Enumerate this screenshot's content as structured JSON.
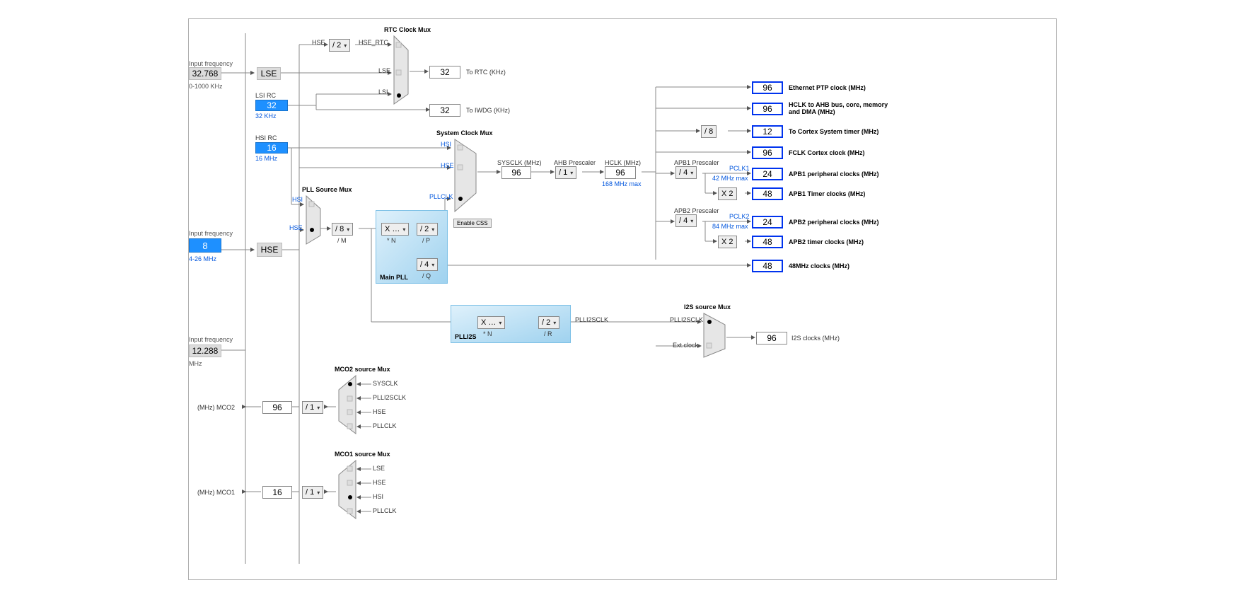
{
  "inputs": {
    "lse_label": "Input frequency",
    "lse_val": "32.768",
    "lse_range": "0-1000 KHz",
    "hse_label": "Input frequency",
    "hse_val": "8",
    "hse_range": "4-26 MHz",
    "i2s_label": "Input frequency",
    "i2s_val": "12.288",
    "i2s_unit": "MHz"
  },
  "sources": {
    "lse": "LSE",
    "lsi_rc": "LSI RC",
    "lsi_val": "32",
    "lsi_unit": "32 KHz",
    "hsi_rc": "HSI RC",
    "hsi_val": "16",
    "hsi_unit": "16 MHz",
    "hse": "HSE"
  },
  "rtc": {
    "title": "RTC Clock Mux",
    "hse_lbl": "HSE",
    "div": "/ 2",
    "hse_rtc": "HSE_RTC",
    "lse_lbl": "LSE",
    "lsi_lbl": "LSI",
    "rtc_val": "32",
    "rtc_lbl": "To RTC (KHz)",
    "iwdg_val": "32",
    "iwdg_lbl": "To IWDG (KHz)"
  },
  "pllsrc": {
    "title": "PLL Source Mux",
    "hsi": "HSI",
    "hse": "HSE",
    "div_m": "/ 8",
    "m_lbl": "/ M"
  },
  "mainpll": {
    "title": "Main PLL",
    "n": "X …",
    "n_lbl": "* N",
    "p": "/ 2",
    "p_lbl": "/ P",
    "q": "/ 4",
    "q_lbl": "/ Q"
  },
  "plli2s": {
    "title": "PLLI2S",
    "n": "X …",
    "n_lbl": "* N",
    "r": "/ 2",
    "r_lbl": "/ R",
    "out_lbl": "PLLI2SCLK"
  },
  "sysclk": {
    "title": "System Clock Mux",
    "hsi": "HSI",
    "hse": "HSE",
    "pllclk": "PLLCLK",
    "enable": "Enable CSS",
    "sysclk_lbl": "SYSCLK (MHz)",
    "sysclk_val": "96",
    "ahb_lbl": "AHB Prescaler",
    "ahb_div": "/ 1",
    "hclk_lbl": "HCLK (MHz)",
    "hclk_val": "96",
    "hclk_max": "168 MHz max"
  },
  "apb1": {
    "lbl": "APB1 Prescaler",
    "div": "/ 4",
    "pclk1": "PCLK1",
    "max": "42 MHz max",
    "tim_mul": "X 2"
  },
  "apb2": {
    "lbl": "APB2 Prescaler",
    "div": "/ 4",
    "pclk2": "PCLK2",
    "max": "84 MHz max",
    "tim_mul": "X 2"
  },
  "cortex_div": "/ 8",
  "outputs": {
    "eth": {
      "val": "96",
      "lbl": "Ethernet PTP clock (MHz)"
    },
    "hclk": {
      "val": "96",
      "lbl": "HCLK to AHB bus, core, memory and DMA (MHz)"
    },
    "cortex": {
      "val": "12",
      "lbl": "To Cortex System timer (MHz)"
    },
    "fclk": {
      "val": "96",
      "lbl": "FCLK Cortex clock (MHz)"
    },
    "apb1p": {
      "val": "24",
      "lbl": "APB1 peripheral clocks (MHz)"
    },
    "apb1t": {
      "val": "48",
      "lbl": "APB1 Timer clocks (MHz)"
    },
    "apb2p": {
      "val": "24",
      "lbl": "APB2 peripheral clocks (MHz)"
    },
    "apb2t": {
      "val": "48",
      "lbl": "APB2 timer clocks (MHz)"
    },
    "usb48": {
      "val": "48",
      "lbl": "48MHz clocks (MHz)"
    }
  },
  "i2smux": {
    "title": "I2S source Mux",
    "in1": "PLLI2SCLK",
    "in2": "Ext.clock",
    "out_val": "96",
    "out_lbl": "I2S clocks (MHz)"
  },
  "mco2": {
    "title": "MCO2 source Mux",
    "ins": [
      "SYSCLK",
      "PLLI2SCLK",
      "HSE",
      "PLLCLK"
    ],
    "div": "/ 1",
    "val": "96",
    "lbl": "(MHz) MCO2"
  },
  "mco1": {
    "title": "MCO1 source Mux",
    "ins": [
      "LSE",
      "HSE",
      "HSI",
      "PLLCLK"
    ],
    "div": "/ 1",
    "val": "16",
    "lbl": "(MHz) MCO1"
  }
}
